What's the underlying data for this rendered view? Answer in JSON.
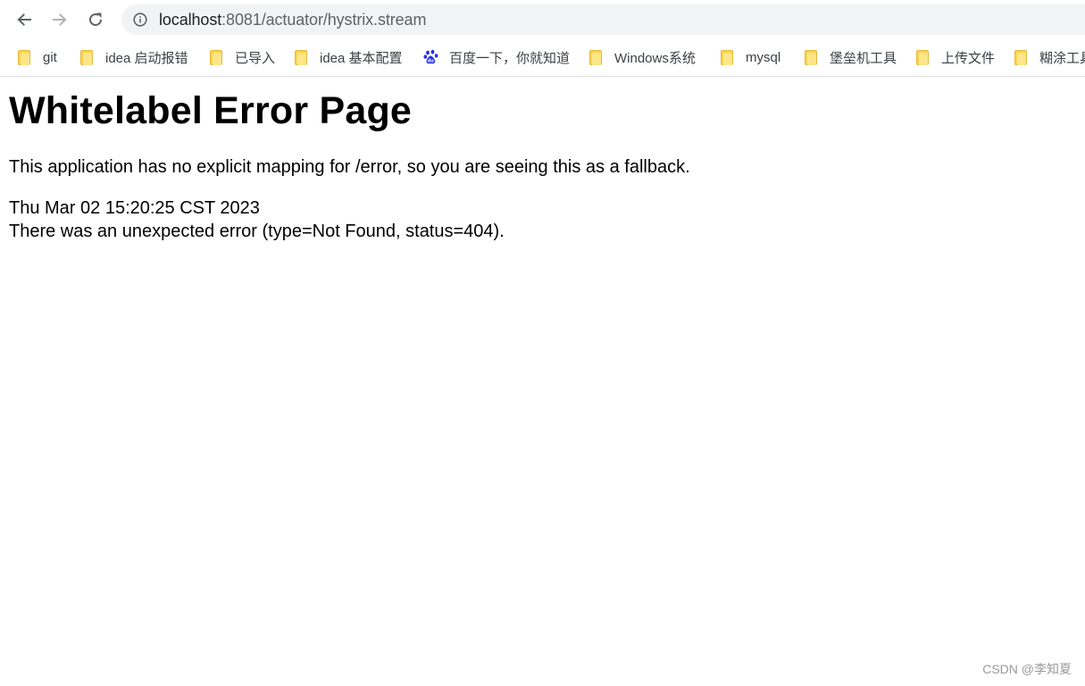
{
  "browser": {
    "url_host": "localhost",
    "url_rest": ":8081/actuator/hystrix.stream",
    "nav_icons": [
      "back-arrow-icon",
      "forward-arrow-icon",
      "reload-icon",
      "info-icon"
    ],
    "bookmarks": [
      {
        "label": "git",
        "icon": "folder-icon"
      },
      {
        "label": "idea 启动报错",
        "icon": "folder-icon"
      },
      {
        "label": "已导入",
        "icon": "folder-icon"
      },
      {
        "label": "idea 基本配置",
        "icon": "folder-icon"
      },
      {
        "label": "百度一下，你就知道",
        "icon": "baidu-paw-icon"
      },
      {
        "label": "Windows系统",
        "icon": "folder-icon"
      },
      {
        "label": "mysql",
        "icon": "folder-icon"
      },
      {
        "label": "堡垒机工具",
        "icon": "folder-icon"
      },
      {
        "label": "上传文件",
        "icon": "folder-icon"
      },
      {
        "label": "糊涂工具",
        "icon": "folder-icon"
      }
    ]
  },
  "page": {
    "title": "Whitelabel Error Page",
    "message": "This application has no explicit mapping for /error, so you are seeing this as a fallback.",
    "timestamp": "Thu Mar 02 15:20:25 CST 2023",
    "error": "There was an unexpected error (type=Not Found, status=404)."
  },
  "watermark": "CSDN @李知夏",
  "colors": {
    "omnibox_bg": "#f1f3f4",
    "folder": "#fcd34d",
    "baidu_blue": "#2932e1"
  }
}
